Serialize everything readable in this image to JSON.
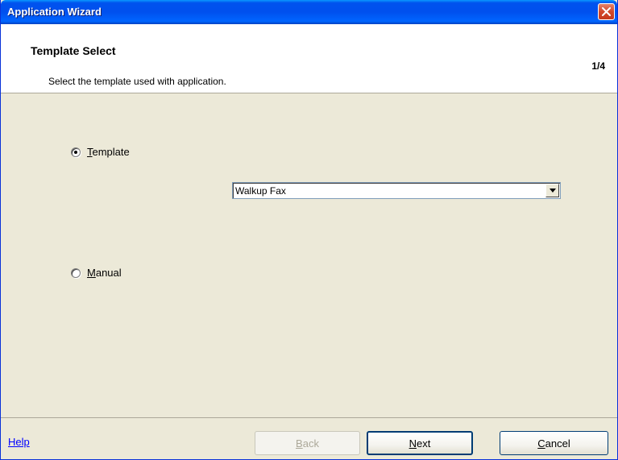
{
  "window": {
    "title": "Application Wizard",
    "close_icon": "close-icon",
    "accent_color": "#0054e3",
    "close_color": "#d2472a"
  },
  "header": {
    "title": "Template Select",
    "step": "1/4",
    "description": "Select the template used with application."
  },
  "options": {
    "template": {
      "label_first": "T",
      "label_rest": "emplate",
      "checked": true
    },
    "template_select": {
      "selected": "Walkup Fax",
      "arrow_icon": "chevron-down-icon"
    },
    "manual": {
      "label_first": "M",
      "label_rest": "anual",
      "checked": false
    }
  },
  "footer": {
    "help_link": "Help",
    "back": {
      "first": "B",
      "rest": "ack",
      "enabled": false
    },
    "next": {
      "first": "N",
      "rest": "ext",
      "enabled": true
    },
    "cancel": {
      "first": "C",
      "rest": "ancel",
      "enabled": true
    }
  }
}
